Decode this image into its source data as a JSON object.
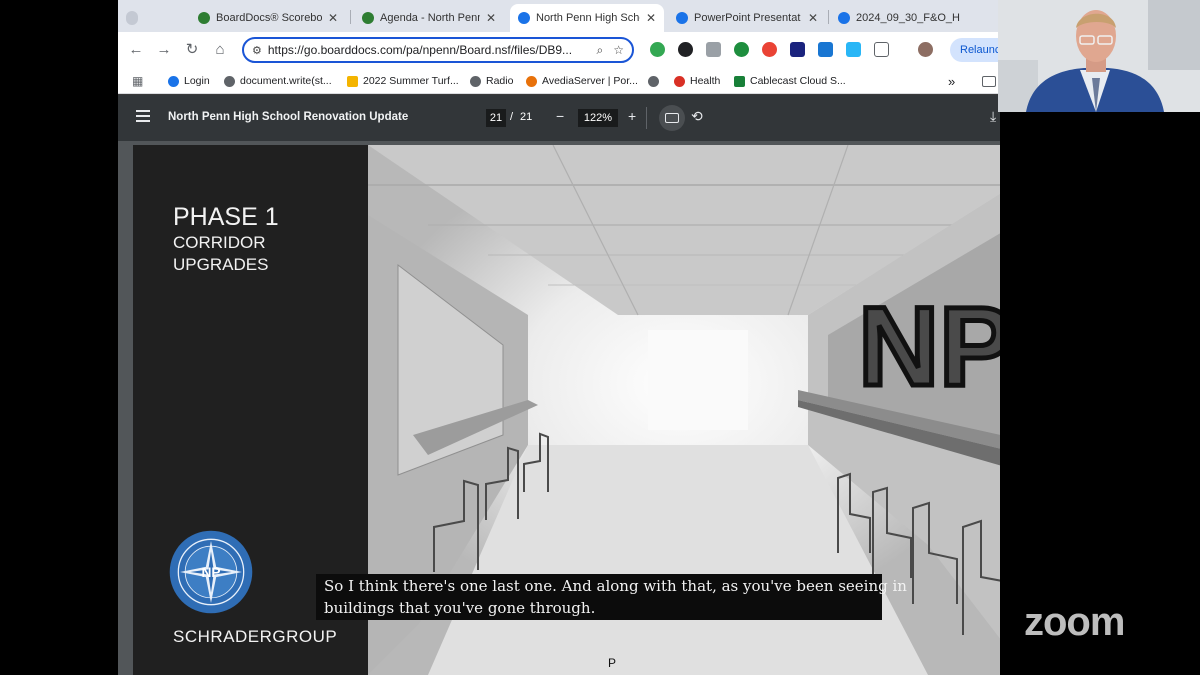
{
  "browser": {
    "tabs": [
      {
        "label": "BoardDocs® Scorebo",
        "icon": "tree-icon",
        "color": "#2e7d32",
        "active": false
      },
      {
        "label": "Agenda - North Penn",
        "icon": "tree-icon",
        "color": "#2e7d32",
        "active": false
      },
      {
        "label": "North Penn High Scho",
        "icon": "globe-icon",
        "color": "#1a73e8",
        "active": true
      },
      {
        "label": "PowerPoint Presentat",
        "icon": "globe-icon",
        "color": "#1a73e8",
        "active": false
      },
      {
        "label": "2024_09_30_F&O_H",
        "icon": "globe-icon",
        "color": "#1a73e8",
        "active": false
      }
    ],
    "url": "https://go.boarddocs.com/pa/npenn/Board.nsf/files/DB9...",
    "relaunch_label": "Relaunch",
    "bookmarks": [
      {
        "label": "Login",
        "color": "#1a73e8"
      },
      {
        "label": "document.write(st...",
        "color": "#5f6368"
      },
      {
        "label": "2022 Summer Turf...",
        "color": "#f4b400"
      },
      {
        "label": "Radio",
        "color": "#5f6368"
      },
      {
        "label": "AvediaServer | Por...",
        "color": "#e8710a"
      },
      {
        "label": "",
        "color": "#5f6368"
      },
      {
        "label": "Health",
        "color": "#d93025"
      },
      {
        "label": "Cablecast Cloud S...",
        "color": "#188038"
      }
    ],
    "bookmarks_overflow": "»"
  },
  "pdf_viewer": {
    "title": "North Penn High School Renovation Update",
    "current_page": "21",
    "page_separator": "/",
    "total_pages": "21",
    "zoom": "122%"
  },
  "slide": {
    "title": "PHASE 1",
    "subtitle_line1": "CORRIDOR",
    "subtitle_line2": "UPGRADES",
    "brand": "SCHRADERGROUP",
    "stray_letter": "P",
    "seal_letters": "NP",
    "wall_logo": "NP",
    "colors": {
      "dark_panel": "#202020",
      "seal_blue": "#2f6db5"
    }
  },
  "caption": {
    "line1": "So I think there's one last one. And along with that, as you've been seeing in",
    "line2": "buildings that you've gone through."
  },
  "zoom_watermark": "zoom"
}
